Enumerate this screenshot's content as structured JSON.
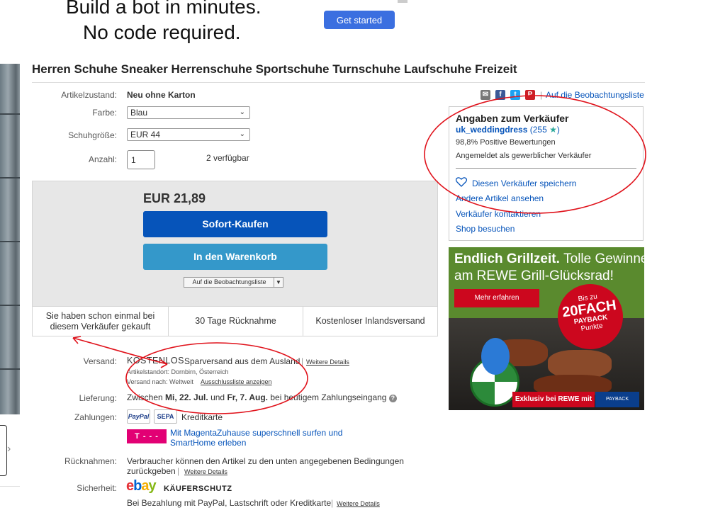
{
  "ad_top": {
    "line1": "Build a bot in minutes.",
    "line2": "No code required.",
    "cta": "Get started"
  },
  "listing": {
    "title": "Herren Schuhe Sneaker Herrenschuhe Sportschuhe Turnschuhe Laufschuhe Freizeit",
    "condition_label": "Artikelzustand:",
    "condition_value": "Neu ohne Karton",
    "color_label": "Farbe:",
    "color_value": "Blau",
    "size_label": "Schuhgröße:",
    "size_value": "EUR 44",
    "qty_label": "Anzahl:",
    "qty_value": "1",
    "available": "2 verfügbar"
  },
  "buybox": {
    "price": "EUR 21,89",
    "buy_now": "Sofort-Kaufen",
    "add_to_cart": "In den Warenkorb",
    "watchlist": "Auf die Beobachtungsliste",
    "feature1": "Sie haben schon einmal bei diesem Verkäufer gekauft",
    "feature2": "30 Tage Rücknahme",
    "feature3": "Kostenloser Inlandsversand"
  },
  "shipping": {
    "label": "Versand:",
    "free": "KOSTENLOS",
    "method": "Sparversand aus dem Ausland",
    "sep": "|",
    "details": "Weitere Details",
    "location": "Artikelstandort:  Dornbirn, Österreich",
    "ships_to": "Versand nach:  Weltweit",
    "exclusions": "Ausschlussliste anzeigen"
  },
  "delivery": {
    "label": "Lieferung:",
    "prefix": "Zwischen",
    "from": "Mi, 22. Jul.",
    "and": "und",
    "to": "Fr, 7. Aug.",
    "suffix": "bei heutigem Zahlungseingang",
    "help": "?"
  },
  "payment": {
    "label": "Zahlungen:",
    "paypal": "PayPal",
    "sepa": "SEPA",
    "card": "Kreditkarte",
    "telekom_logo": "T - - -",
    "promo_line1": "Mit MagentaZuhause superschnell surfen und",
    "promo_line2": "SmartHome erleben"
  },
  "returns": {
    "label": "Rücknahmen:",
    "line1": "Verbraucher können den Artikel zu den unten angegebenen Bedingungen",
    "line2": "zurückgeben",
    "sep": "|",
    "details": "Weitere Details"
  },
  "security": {
    "label": "Sicherheit:",
    "ebay": [
      "e",
      "b",
      "a",
      "y"
    ],
    "protection": "KÄUFERSCHUTZ",
    "note": "Bei Bezahlung mit PayPal, Lastschrift oder Kreditkarte",
    "sep": "|",
    "details": "Weitere Details"
  },
  "share": {
    "email": "✉",
    "facebook": "f",
    "twitter": "t",
    "pinterest": "P",
    "sep": "|",
    "watchlist": "Auf die Beobachtungsliste"
  },
  "seller": {
    "title": "Angaben zum Verkäufer",
    "name": "uk_weddingdress",
    "score_open": "(255",
    "star": "★",
    "score_close": ")",
    "positive": "98,8% Positive Bewertungen",
    "business": "Angemeldet als gewerblicher Verkäufer",
    "save": "Diesen Verkäufer speichern",
    "other_items": "Andere Artikel ansehen",
    "contact": "Verkäufer kontaktieren",
    "shop": "Shop besuchen"
  },
  "rewe_ad": {
    "headline_bold": "Endlich Grillzeit.",
    "headline_rest": "Tolle Gewinne",
    "line2": "am REWE Grill-Glücksrad!",
    "cta": "Mehr erfahren",
    "badge1": "Bis zu",
    "badge2": "20FACH",
    "badge3": "PAYBACK",
    "badge4": "Punkte",
    "exclusive": "Exklusiv bei REWE mit",
    "payback": "PAYBACK"
  },
  "colors": {
    "buy_button": "#0654ba",
    "cart_button": "#3498ca",
    "link": "#0654ba",
    "annotation": "#e0121b"
  }
}
